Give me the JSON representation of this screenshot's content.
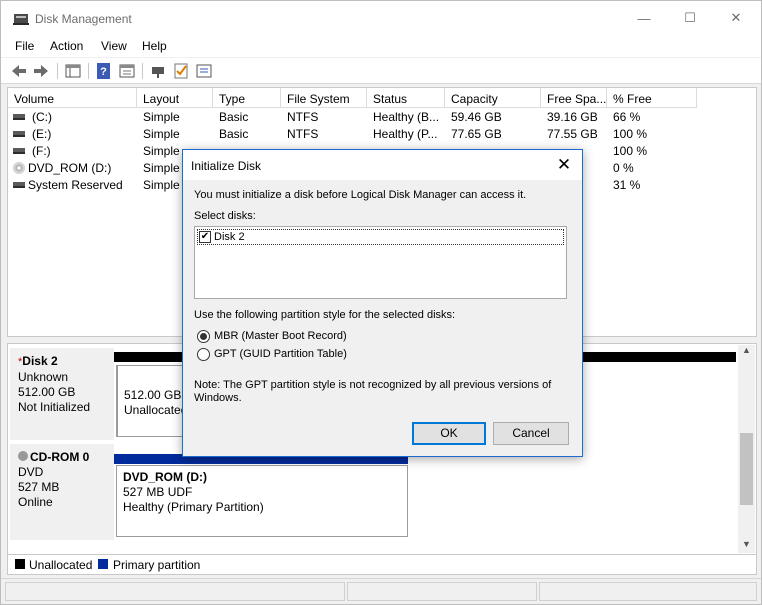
{
  "window": {
    "title": "Disk Management"
  },
  "menu": [
    "File",
    "Action",
    "View",
    "Help"
  ],
  "toolbar_icons": [
    "back-arrow-icon",
    "forward-arrow-icon",
    "disk-list-icon",
    "help-icon",
    "properties-icon",
    "connect-icon",
    "check-icon",
    "console-icon"
  ],
  "volume_table": {
    "headers": [
      "Volume",
      "Layout",
      "Type",
      "File System",
      "Status",
      "Capacity",
      "Free Spa...",
      "% Free"
    ],
    "rows": [
      {
        "volume": "(C:)",
        "layout": "Simple",
        "type": "Basic",
        "fs": "NTFS",
        "status": "Healthy (B...",
        "capacity": "59.46 GB",
        "free": "39.16 GB",
        "pct": "66 %"
      },
      {
        "volume": "(E:)",
        "layout": "Simple",
        "type": "Basic",
        "fs": "NTFS",
        "status": "Healthy (P...",
        "capacity": "77.65 GB",
        "free": "77.55 GB",
        "pct": "100 %"
      },
      {
        "volume": "(F:)",
        "layout": "Simple",
        "type": "",
        "fs": "",
        "status": "",
        "capacity": "",
        "free": "",
        "pct": "100 %"
      },
      {
        "volume": "DVD_ROM (D:)",
        "layout": "Simple",
        "type": "",
        "fs": "",
        "status": "",
        "capacity": "",
        "free": "",
        "pct": "0 %"
      },
      {
        "volume": "System Reserved",
        "layout": "Simple",
        "type": "",
        "fs": "",
        "status": "",
        "capacity": "",
        "free": "",
        "pct": "31 %"
      }
    ]
  },
  "disks": {
    "disk2": {
      "name": "Disk 2",
      "type": "Unknown",
      "size": "512.00 GB",
      "state": "Not Initialized",
      "partition_size": "512.00 GB",
      "partition_state": "Unallocated"
    },
    "cdrom0": {
      "name": "CD-ROM 0",
      "type": "DVD",
      "size": "527 MB",
      "state": "Online",
      "partition_name": "DVD_ROM  (D:)",
      "partition_fs": "527 MB UDF",
      "partition_status": "Healthy (Primary Partition)"
    }
  },
  "legend": {
    "unallocated": "Unallocated",
    "primary": "Primary partition",
    "colors": {
      "unallocated": "#000000",
      "primary": "#002b9c"
    }
  },
  "dialog": {
    "title": "Initialize Disk",
    "intro": "You must initialize a disk before Logical Disk Manager can access it.",
    "select_label": "Select disks:",
    "disk_entry": "Disk 2",
    "disk_checked": true,
    "style_label": "Use the following partition style for the selected disks:",
    "options": [
      "MBR (Master Boot Record)",
      "GPT (GUID Partition Table)"
    ],
    "selected_option": "MBR (Master Boot Record)",
    "note": "Note: The GPT partition style is not recognized by all previous versions of Windows.",
    "ok": "OK",
    "cancel": "Cancel"
  }
}
